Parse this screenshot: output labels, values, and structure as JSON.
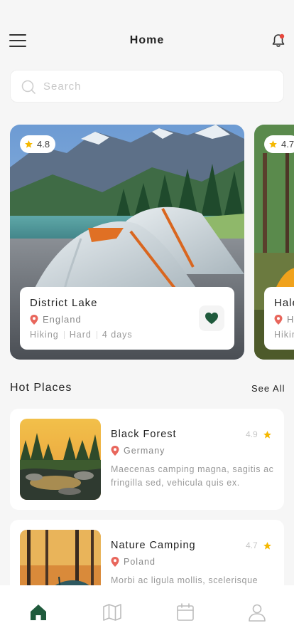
{
  "header": {
    "title": "Home"
  },
  "search": {
    "placeholder": "Search"
  },
  "featured": [
    {
      "rating": "4.8",
      "title": "District Lake",
      "location": "England",
      "activity": "Hiking",
      "difficulty": "Hard",
      "duration": "4 days",
      "favorited": true
    },
    {
      "rating": "4.7",
      "title": "Hale",
      "location": "H",
      "activity": "Hikin"
    }
  ],
  "hot_places": {
    "title": "Hot Places",
    "see_all": "See All",
    "items": [
      {
        "title": "Black Forest",
        "rating": "4.9",
        "location": "Germany",
        "description": "Maecenas camping magna, sagitis ac fringilla sed, vehicula quis ex."
      },
      {
        "title": "Nature Camping",
        "rating": "4.7",
        "location": "Poland",
        "description": "Morbi ac ligula mollis, scelerisque"
      }
    ]
  },
  "nav": {
    "items": [
      "home-icon",
      "map-icon",
      "calendar-icon",
      "profile-icon"
    ],
    "active": "home-icon"
  },
  "colors": {
    "accent": "#1f5a3c",
    "star": "#f5b800",
    "pin": "#e8665c",
    "bell_dot": "#e8463c"
  }
}
